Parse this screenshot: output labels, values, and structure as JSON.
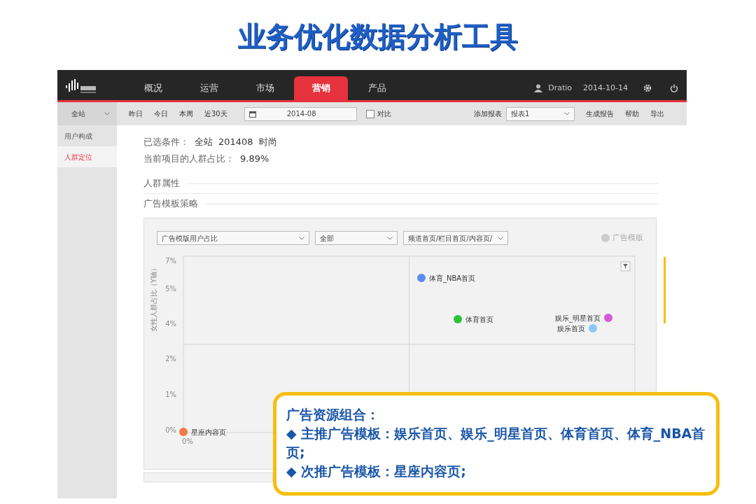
{
  "slide_title": "业务优化数据分析工具",
  "app": {
    "nav_tabs": [
      {
        "label": "概况",
        "selected": false
      },
      {
        "label": "运营",
        "selected": false
      },
      {
        "label": "市场",
        "selected": false
      },
      {
        "label": "营销",
        "selected": true
      },
      {
        "label": "产品",
        "selected": false
      }
    ],
    "user": "Dratio",
    "date": "2014-10-14",
    "toolbar": {
      "site_select": "全站",
      "quick_ranges": [
        "昨日",
        "今日",
        "本周",
        "近30天"
      ],
      "month": "2014-08",
      "compare": {
        "label": "对比",
        "checked": false
      },
      "add_report_label": "添加报表",
      "report_select": "报表1",
      "actions": [
        "生成报告",
        "帮助",
        "导出"
      ]
    },
    "sidebar": {
      "items": [
        {
          "label": "用户构成",
          "selected": false
        },
        {
          "label": "人群定位",
          "selected": true
        }
      ]
    },
    "conditions": {
      "label": "已选条件：",
      "values": [
        "全站",
        "201408",
        "时尚"
      ]
    },
    "ratio": {
      "label": "当前项目的人群占比：",
      "value": "9.89%"
    },
    "sections": [
      "人群属性",
      "广告模板策略"
    ],
    "filters": [
      "广告模版用户占比",
      "全部",
      "频道首页/栏目首页/内容页/"
    ],
    "legend": "广告模版",
    "plot": {
      "y_axis_title": "女性人群占比（Y轴）",
      "y_axis_labels": [
        "7%",
        "5%",
        "4%",
        "2%",
        "1%",
        "0%"
      ],
      "x_axis_labels": [
        "0%"
      ],
      "points": [
        {
          "label": "体育_NBA首页",
          "color": "#5b8def"
        },
        {
          "label": "体育首页",
          "color": "#2cc33a"
        },
        {
          "label": "娱乐_明星首页",
          "color": "#d65ad6"
        },
        {
          "label": "娱乐首页",
          "color": "#8cc8f5"
        },
        {
          "label": "星座内容页",
          "color": "#f47a45"
        }
      ]
    }
  },
  "callout": {
    "title": "广告资源组合：",
    "bullet": "◆",
    "lines": [
      "主推广告模板：娱乐首页、娱乐_明星首页、体育首页、体育_NBA首页;",
      "次推广告模板：星座内容页;"
    ]
  }
}
